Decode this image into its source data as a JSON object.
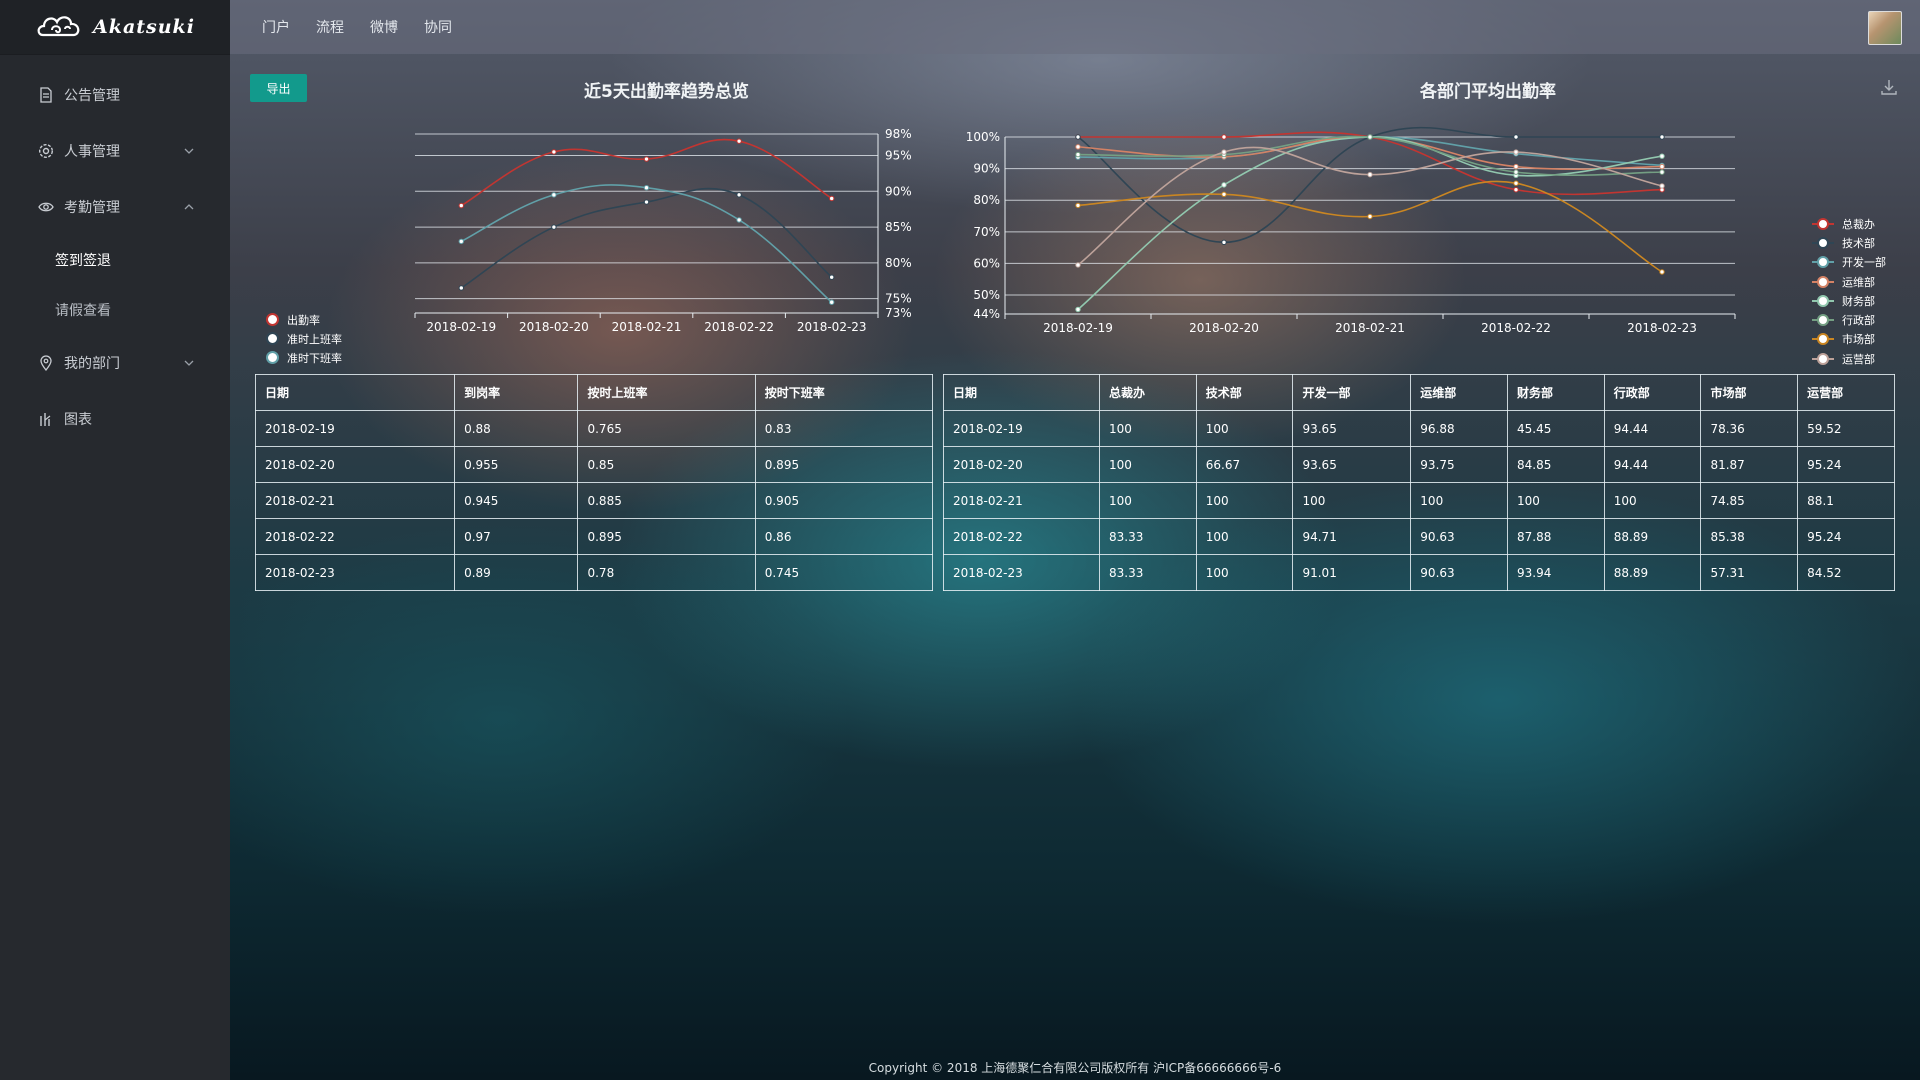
{
  "brand": "Akatsuki",
  "sidebar": {
    "items": [
      {
        "label": "公告管理",
        "icon": "document-icon"
      },
      {
        "label": "人事管理",
        "icon": "settings-icon"
      },
      {
        "label": "考勤管理",
        "icon": "eye-icon"
      },
      {
        "label": "我的部门",
        "icon": "location-icon"
      },
      {
        "label": "图表",
        "icon": "chart-icon"
      }
    ],
    "subitems": [
      "签到签退",
      "请假查看"
    ]
  },
  "topnav": [
    "门户",
    "流程",
    "微博",
    "协同"
  ],
  "export_label": "导出",
  "charts": {
    "left_title": "近5天出勤率趋势总览",
    "right_title": "各部门平均出勤率"
  },
  "chart_data": [
    {
      "type": "line",
      "title": "近5天出勤率趋势总览",
      "categories": [
        "2018-02-19",
        "2018-02-20",
        "2018-02-21",
        "2018-02-22",
        "2018-02-23"
      ],
      "y_ticks": [
        "98%",
        "95%",
        "90%",
        "85%",
        "80%",
        "75%",
        "73%"
      ],
      "ylim": [
        0.73,
        0.98
      ],
      "legend_position": "left",
      "series": [
        {
          "name": "出勤率",
          "color": "#c23531",
          "values": [
            0.88,
            0.955,
            0.945,
            0.97,
            0.89
          ]
        },
        {
          "name": "准时上班率",
          "color": "#2f4554",
          "values": [
            0.765,
            0.85,
            0.885,
            0.895,
            0.78
          ]
        },
        {
          "name": "准时下班率",
          "color": "#61a0a8",
          "values": [
            0.83,
            0.895,
            0.905,
            0.86,
            0.745
          ]
        }
      ]
    },
    {
      "type": "line",
      "title": "各部门平均出勤率",
      "categories": [
        "2018-02-19",
        "2018-02-20",
        "2018-02-21",
        "2018-02-22",
        "2018-02-23"
      ],
      "y_ticks": [
        "100%",
        "90%",
        "80%",
        "70%",
        "60%",
        "50%",
        "44%"
      ],
      "ylim": [
        44,
        100
      ],
      "legend_position": "right",
      "series": [
        {
          "name": "总裁办",
          "color": "#c23531",
          "values": [
            100,
            100,
            100,
            83.33,
            83.33
          ]
        },
        {
          "name": "技术部",
          "color": "#2f4554",
          "values": [
            100,
            66.67,
            100,
            100,
            100
          ]
        },
        {
          "name": "开发一部",
          "color": "#61a0a8",
          "values": [
            93.65,
            93.65,
            100,
            94.71,
            91.01
          ]
        },
        {
          "name": "运维部",
          "color": "#d48265",
          "values": [
            96.88,
            93.75,
            100,
            90.63,
            90.63
          ]
        },
        {
          "name": "财务部",
          "color": "#91c7ae",
          "values": [
            45.45,
            84.85,
            100,
            87.88,
            93.94
          ]
        },
        {
          "name": "行政部",
          "color": "#749f83",
          "values": [
            94.44,
            94.44,
            100,
            88.89,
            88.89
          ]
        },
        {
          "name": "市场部",
          "color": "#ca8622",
          "values": [
            78.36,
            81.87,
            74.85,
            85.38,
            57.31
          ]
        },
        {
          "name": "运营部",
          "color": "#bda29a",
          "values": [
            59.52,
            95.24,
            88.1,
            95.24,
            84.52
          ]
        }
      ]
    }
  ],
  "left_table": {
    "headers": [
      "日期",
      "到岗率",
      "按时上班率",
      "按时下班率"
    ],
    "rows": [
      [
        "2018-02-19",
        "0.88",
        "0.765",
        "0.83"
      ],
      [
        "2018-02-20",
        "0.955",
        "0.85",
        "0.895"
      ],
      [
        "2018-02-21",
        "0.945",
        "0.885",
        "0.905"
      ],
      [
        "2018-02-22",
        "0.97",
        "0.895",
        "0.86"
      ],
      [
        "2018-02-23",
        "0.89",
        "0.78",
        "0.745"
      ]
    ]
  },
  "right_table": {
    "headers": [
      "日期",
      "总裁办",
      "技术部",
      "开发一部",
      "运维部",
      "财务部",
      "行政部",
      "市场部",
      "运营部"
    ],
    "rows": [
      [
        "2018-02-19",
        "100",
        "100",
        "93.65",
        "96.88",
        "45.45",
        "94.44",
        "78.36",
        "59.52"
      ],
      [
        "2018-02-20",
        "100",
        "66.67",
        "93.65",
        "93.75",
        "84.85",
        "94.44",
        "81.87",
        "95.24"
      ],
      [
        "2018-02-21",
        "100",
        "100",
        "100",
        "100",
        "100",
        "100",
        "74.85",
        "88.1"
      ],
      [
        "2018-02-22",
        "83.33",
        "100",
        "94.71",
        "90.63",
        "87.88",
        "88.89",
        "85.38",
        "95.24"
      ],
      [
        "2018-02-23",
        "83.33",
        "100",
        "91.01",
        "90.63",
        "93.94",
        "88.89",
        "57.31",
        "84.52"
      ]
    ]
  },
  "footer": "Copyright © 2018 上海德聚仁合有限公司版权所有 沪ICP备66666666号-6"
}
